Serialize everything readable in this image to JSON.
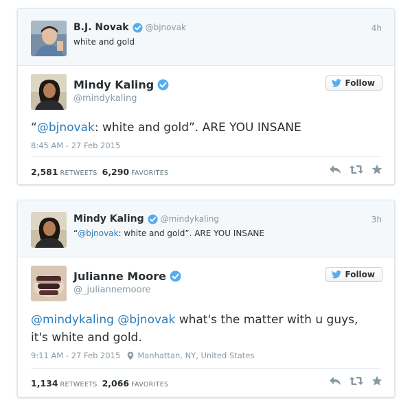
{
  "tweet1": {
    "context": {
      "name": "B.J. Novak",
      "handle": "@bjnovak",
      "text": "white and gold",
      "time": "4h"
    },
    "main": {
      "name": "Mindy Kaling",
      "handle": "@mindykaling",
      "follow_label": "Follow",
      "text_open_quote": "“",
      "text_mention": "@bjnovak",
      "text_rest": ": white and gold”. ARE YOU INSANE",
      "timestamp": "8:45 AM - 27 Feb 2015",
      "retweets": "2,581",
      "retweets_label": "RETWEETS",
      "favorites": "6,290",
      "favorites_label": "FAVORITES"
    }
  },
  "tweet2": {
    "context": {
      "name": "Mindy Kaling",
      "handle": "@mindykaling",
      "text_open_quote": "“",
      "text_mention": "@bjnovak",
      "text_rest": ": white and gold”. ARE YOU INSANE",
      "time": "3h"
    },
    "main": {
      "name": "Julianne Moore",
      "handle": "@_juliannemoore",
      "follow_label": "Follow",
      "text_mention1": "@mindykaling",
      "text_mention2": "@bjnovak",
      "text_rest_line1": " what's the matter with u guys,",
      "text_line2": "it's white and gold.",
      "timestamp": "9:11 AM - 27 Feb 2015",
      "location": "Manhattan, NY, United States",
      "retweets": "1,134",
      "retweets_label": "RETWEETS",
      "favorites": "2,066",
      "favorites_label": "FAVORITES"
    }
  },
  "icons": {
    "verified": "verified-badge-icon",
    "twitter": "twitter-bird-icon",
    "reply": "reply-icon",
    "retweet": "retweet-icon",
    "favorite": "star-icon",
    "location": "location-pin-icon"
  },
  "colors": {
    "link": "#2b7bb9",
    "verified": "#55acee",
    "muted": "#8899a6",
    "action_icon": "#8899a6"
  }
}
